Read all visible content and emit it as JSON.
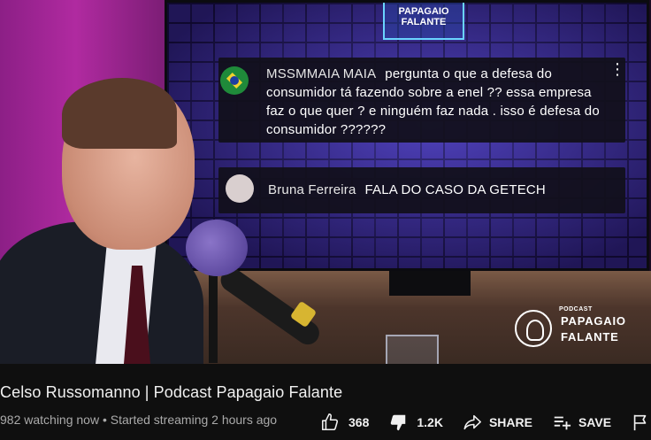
{
  "video": {
    "tv_logo_text": "PAPAGAIO FALANTE",
    "chat": [
      {
        "author": "MSSMMAIA MAIA",
        "message": "pergunta o que a defesa do consumidor tá fazendo sobre a enel ?? essa empresa faz o que quer ? e ninguém faz nada . isso é defesa do consumidor ??????"
      },
      {
        "author": "Bruna Ferreira",
        "message": "FALA DO CASO DA GETECH"
      }
    ],
    "watermark": {
      "small": "PODCAST",
      "line1": "PAPAGAIO",
      "line2": "FALANTE"
    }
  },
  "title": "Celso Russomanno | Podcast Papagaio Falante",
  "meta": {
    "watching": "982 watching now",
    "separator": "•",
    "started": "Started streaming 2 hours ago"
  },
  "actions": {
    "like_count": "368",
    "dislike_count": "1.2K",
    "share_label": "SHARE",
    "save_label": "SAVE"
  },
  "icons": {
    "like": "thumb-up-icon",
    "dislike": "thumb-down-icon",
    "share": "share-arrow-icon",
    "save": "playlist-add-icon",
    "report": "flag-icon"
  }
}
